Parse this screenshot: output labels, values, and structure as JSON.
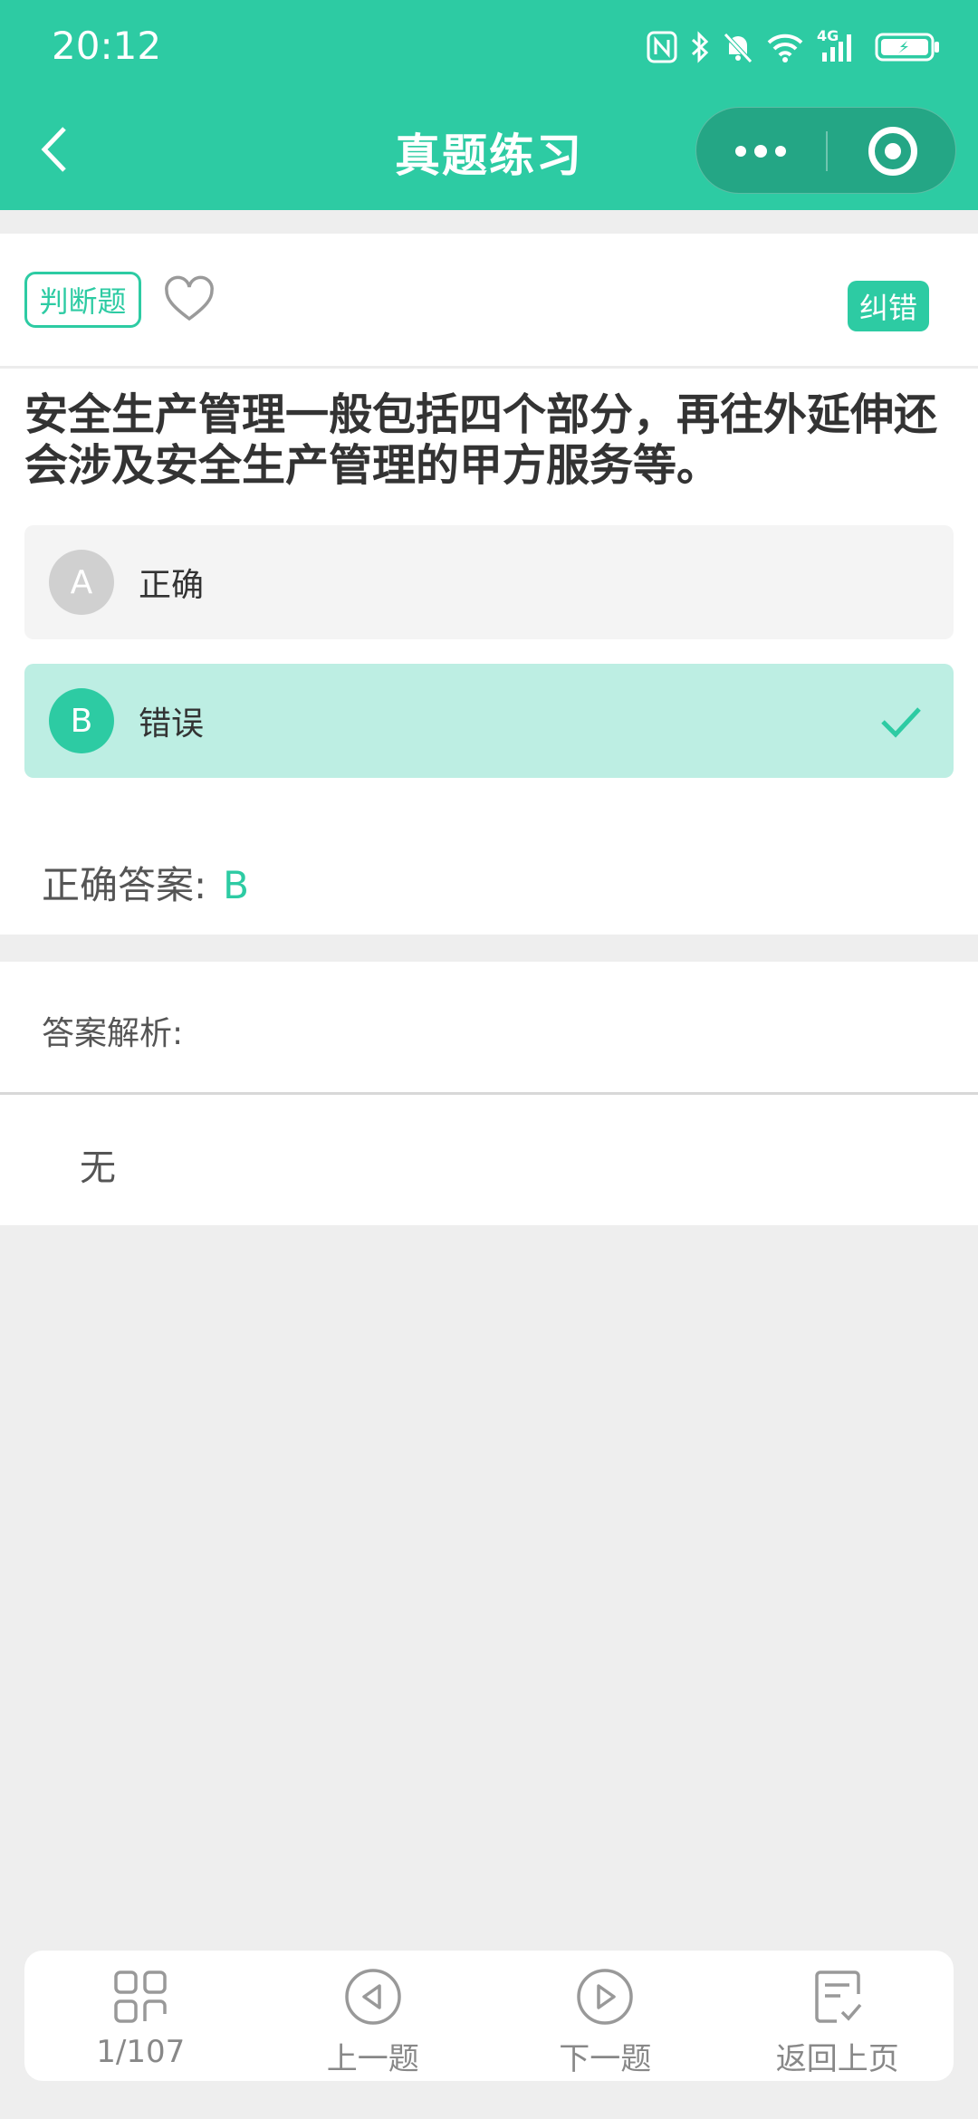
{
  "status_bar": {
    "time": "20:12",
    "network": "4G",
    "icons": [
      "nfc-icon",
      "bluetooth-icon",
      "mute-icon",
      "wifi-icon",
      "signal-icon",
      "battery-charging-icon"
    ]
  },
  "nav": {
    "title": "真题练习",
    "back_icon": "chevron-left-icon",
    "more_icon": "more-dots-icon",
    "close_icon": "target-close-icon"
  },
  "question": {
    "type_tag": "判断题",
    "correct_button": "纠错",
    "text": "安全生产管理一般包括四个部分，再往外延伸还会涉及安全生产管理的甲方服务等。",
    "options": [
      {
        "letter": "A",
        "label": "正确",
        "selected": false
      },
      {
        "letter": "B",
        "label": "错误",
        "selected": true
      }
    ],
    "answer_label": "正确答案:",
    "answer_value": "B"
  },
  "analysis": {
    "label": "答案解析:",
    "text": "无"
  },
  "bottom_bar": {
    "progress": "1/107",
    "prev": "上一题",
    "next": "下一题",
    "back": "返回上页"
  },
  "colors": {
    "accent": "#2dcba3",
    "selected_bg": "#bdeee3",
    "page_bg": "#eeeeee"
  }
}
